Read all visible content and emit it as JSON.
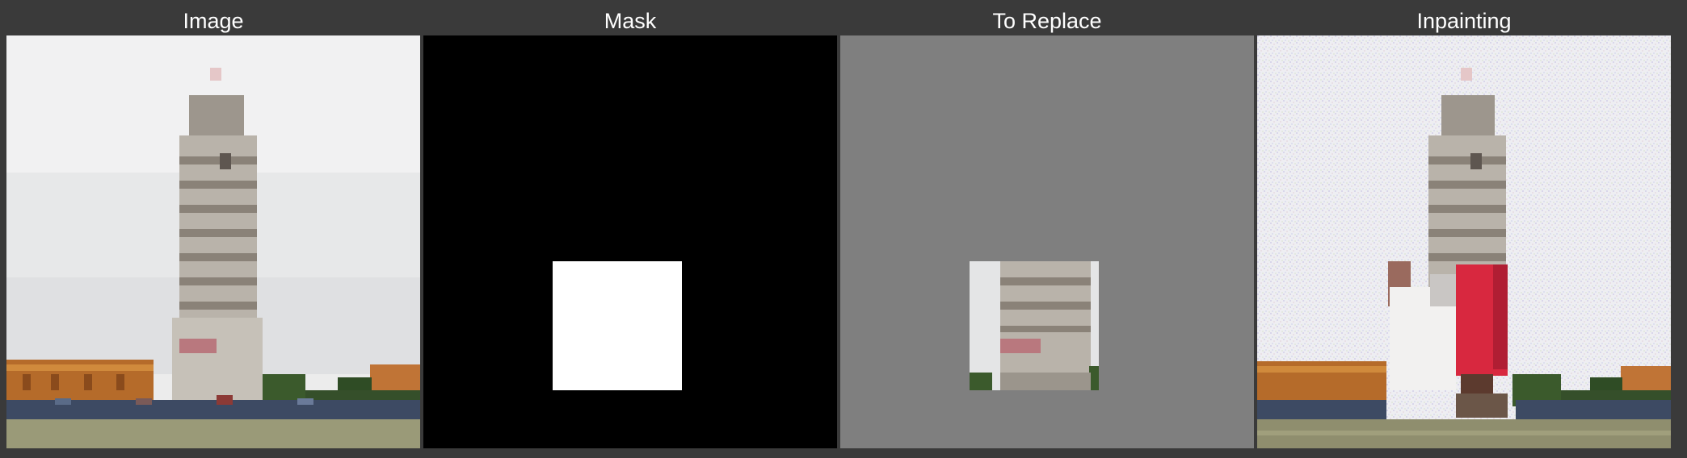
{
  "panels": [
    {
      "id": "image",
      "title": "Image"
    },
    {
      "id": "mask",
      "title": "Mask"
    },
    {
      "id": "to-replace",
      "title": "To Replace"
    },
    {
      "id": "inpainting",
      "title": "Inpainting"
    }
  ],
  "colors": {
    "background": "#3a3a3a",
    "title_text": "#ffffff",
    "mask_black": "#000000",
    "mask_white": "#ffffff",
    "replace_gray": "#7f7f7f",
    "sky": "#ecedee",
    "tower_stone": "#b9b3aa",
    "tower_shadow": "#8a8278",
    "grass": "#9a9a78",
    "trees": "#3b5a2c",
    "buildings": "#b56b2a",
    "crowd": "#3d4a63",
    "red_figure": "#d8283f",
    "white_figure": "#f2f1f0"
  }
}
